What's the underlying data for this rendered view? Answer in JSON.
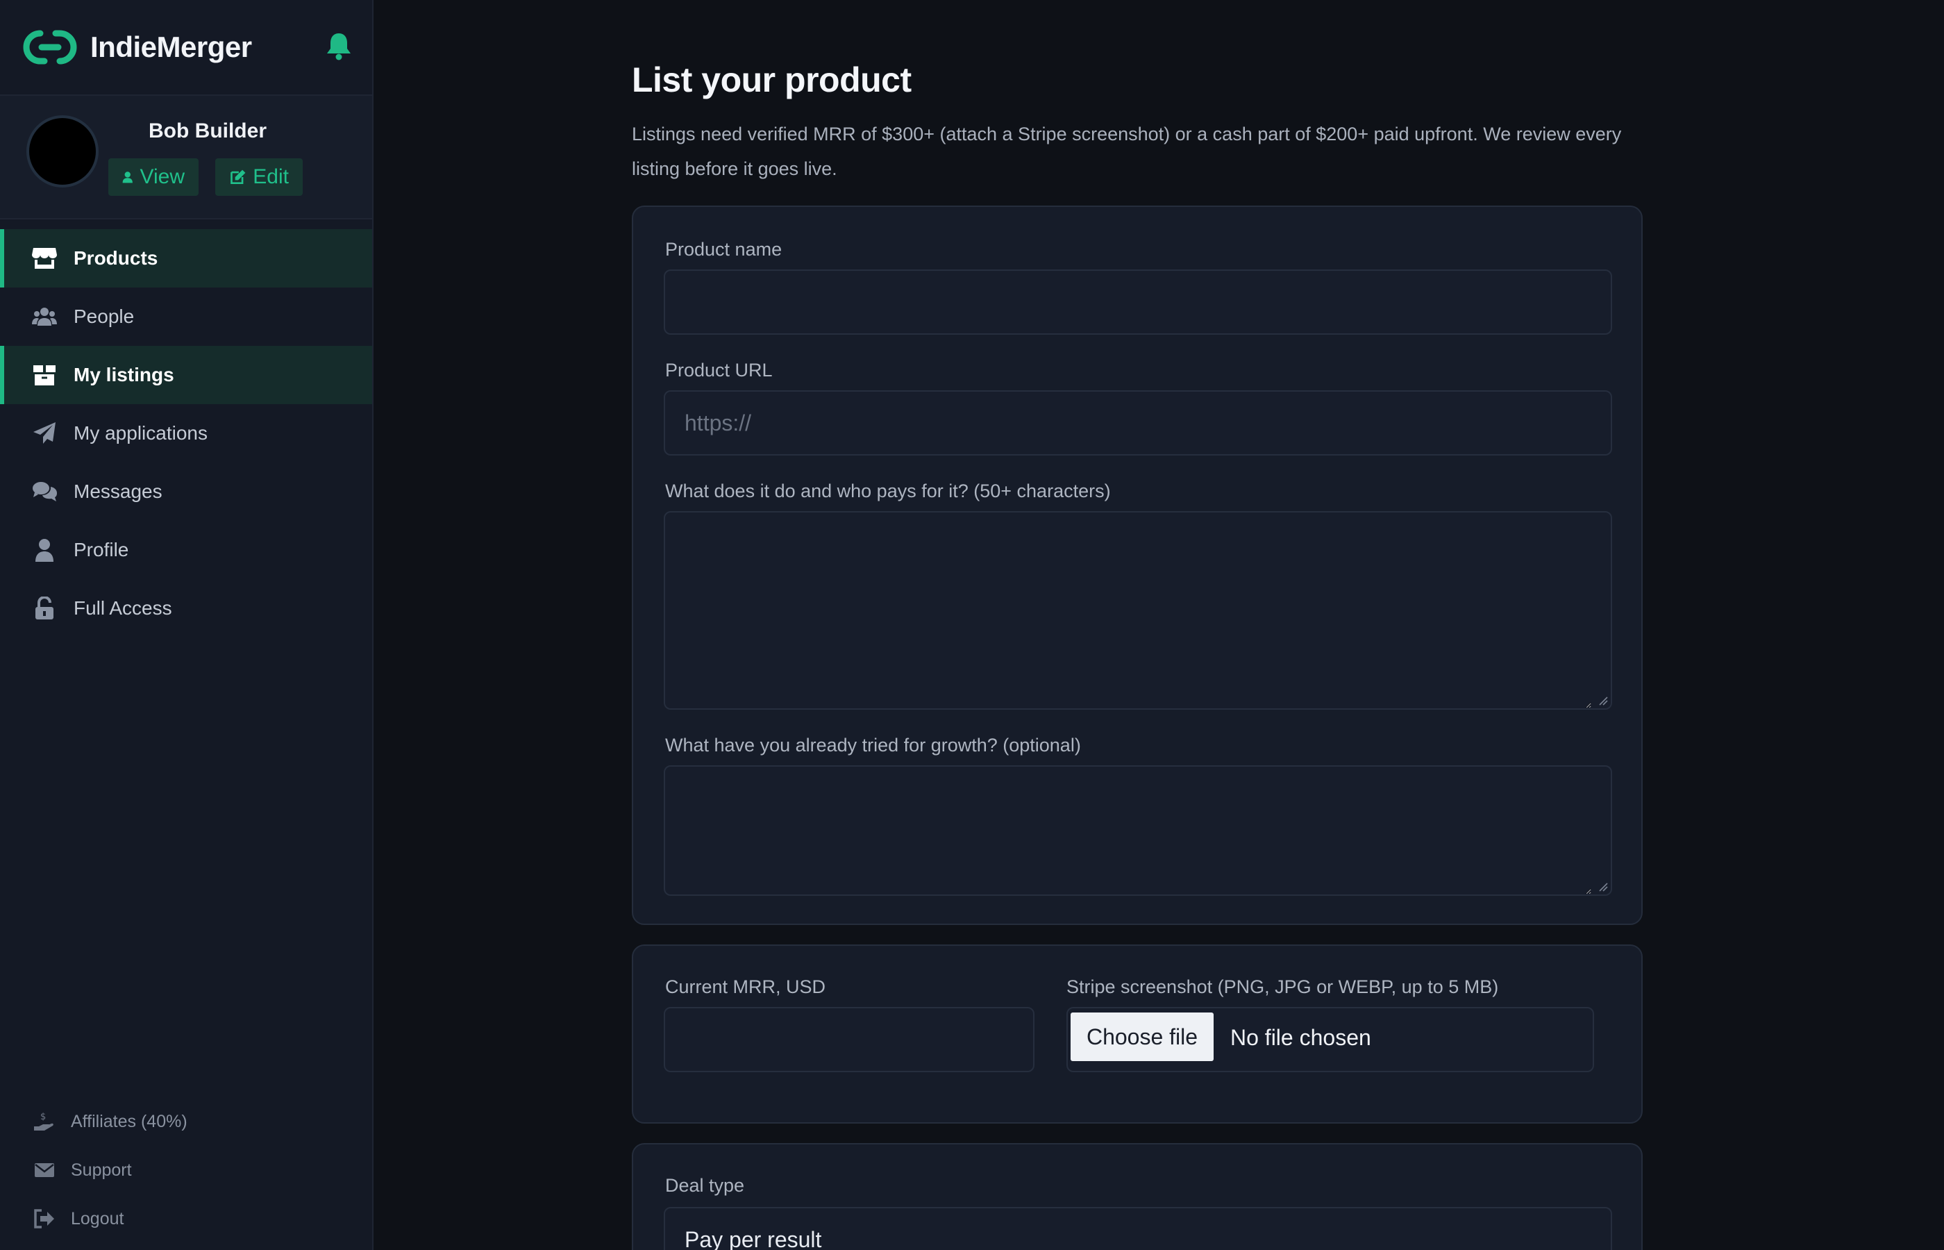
{
  "brand": {
    "name": "IndieMerger"
  },
  "user": {
    "name": "Bob Builder",
    "view_label": "View",
    "edit_label": "Edit"
  },
  "nav": {
    "items": [
      {
        "label": "Products",
        "icon": "store-icon",
        "active": true
      },
      {
        "label": "People",
        "icon": "users-icon",
        "active": false
      },
      {
        "label": "My listings",
        "icon": "box-icon",
        "active": true
      },
      {
        "label": "My applications",
        "icon": "paper-plane-icon",
        "active": false
      },
      {
        "label": "Messages",
        "icon": "comments-icon",
        "active": false
      },
      {
        "label": "Profile",
        "icon": "user-icon",
        "active": false
      },
      {
        "label": "Full Access",
        "icon": "unlock-icon",
        "active": false
      }
    ]
  },
  "footer_nav": {
    "items": [
      {
        "label": "Affiliates (40%)",
        "icon": "hand-dollar-icon"
      },
      {
        "label": "Support",
        "icon": "envelope-icon"
      },
      {
        "label": "Logout",
        "icon": "logout-icon"
      }
    ]
  },
  "page": {
    "title": "List your product",
    "description": "Listings need verified MRR of $300+ (attach a Stripe screenshot) or a cash part of $200+ paid upfront. We review every listing before it goes live."
  },
  "form": {
    "product_name": {
      "label": "Product name",
      "value": "",
      "placeholder": ""
    },
    "product_url": {
      "label": "Product URL",
      "value": "",
      "placeholder": "https://"
    },
    "description": {
      "label": "What does it do and who pays for it? (50+ characters)",
      "value": ""
    },
    "growth": {
      "label": "What have you already tried for growth? (optional)",
      "value": ""
    },
    "mrr": {
      "label": "Current MRR, USD",
      "value": ""
    },
    "stripe": {
      "label": "Stripe screenshot (PNG, JPG or WEBP, up to 5 MB)",
      "button": "Choose file",
      "status": "No file chosen"
    },
    "deal_type": {
      "label": "Deal type",
      "value": "Pay per result"
    }
  },
  "colors": {
    "accent": "#1fb985",
    "background": "#0e1117",
    "sidebar": "#141925",
    "card": "#161c29"
  }
}
